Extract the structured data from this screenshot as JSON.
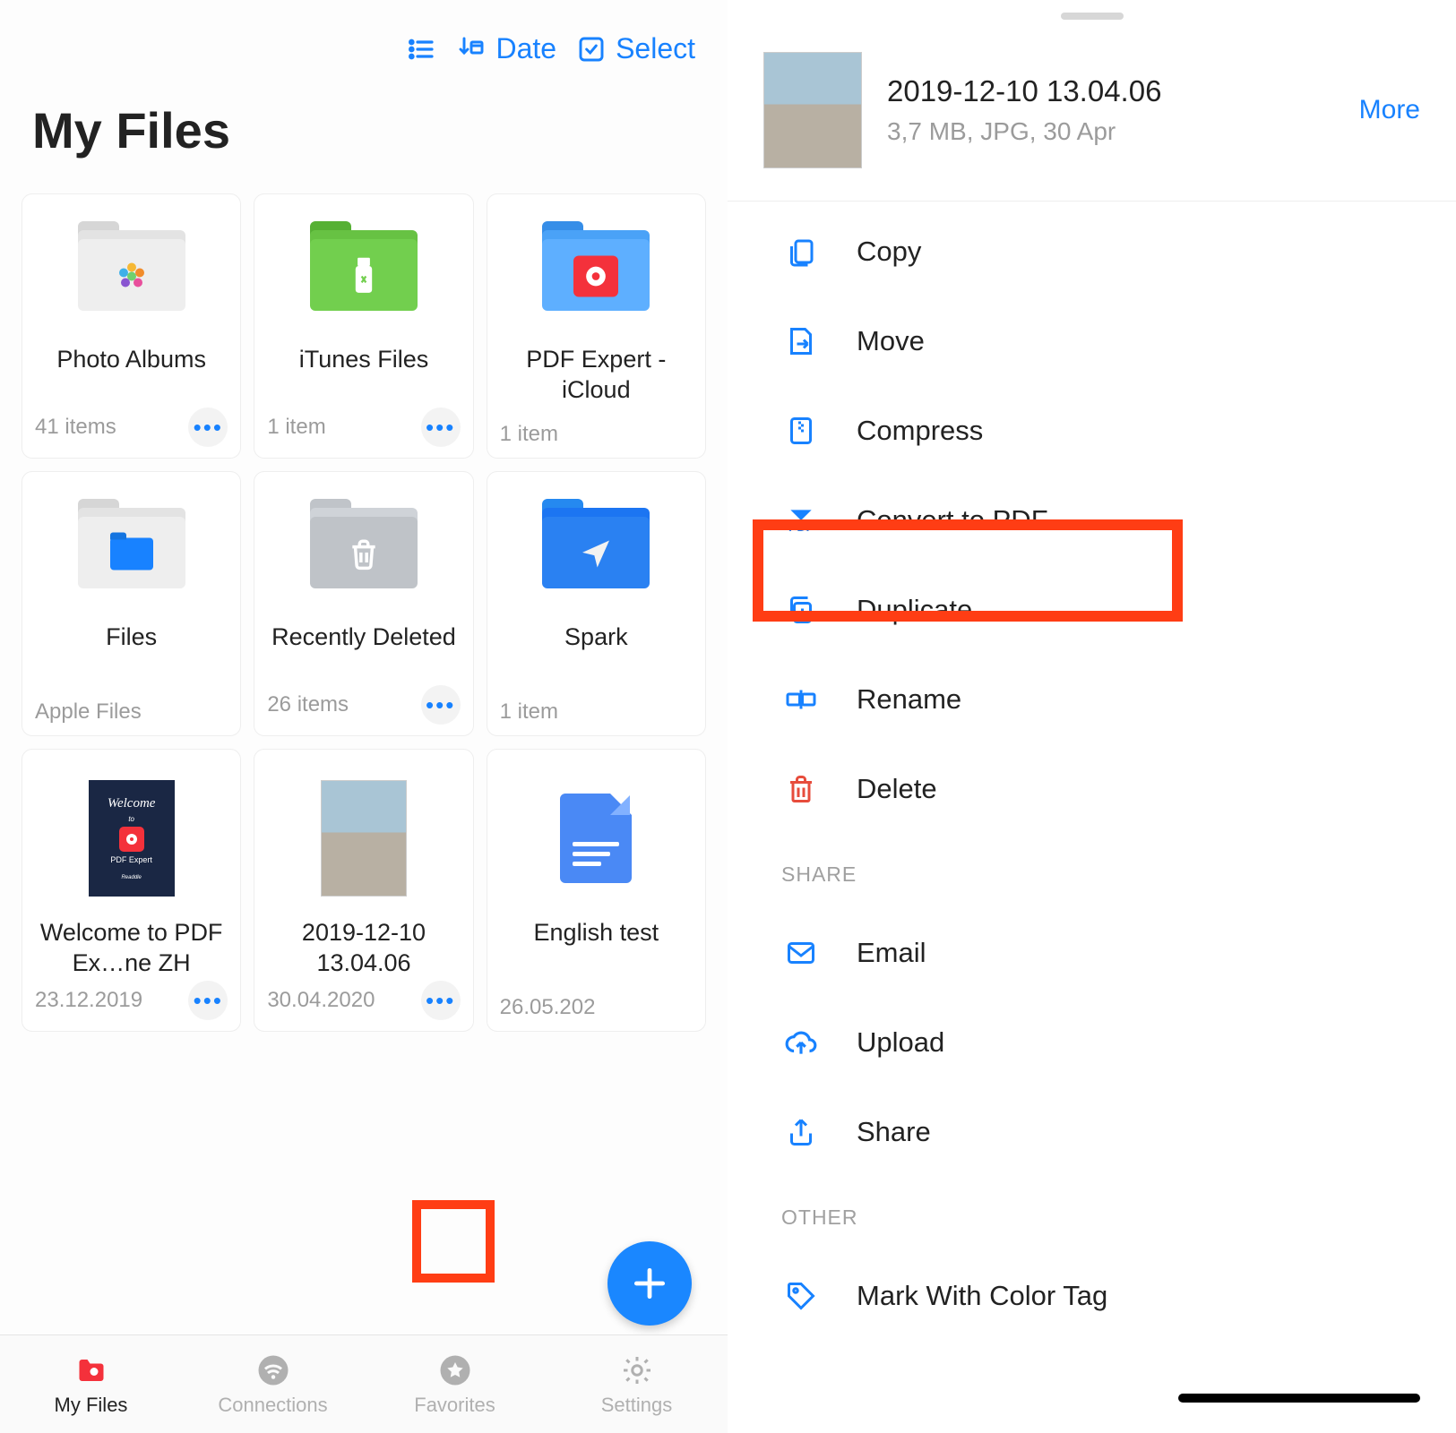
{
  "toolbar": {
    "date_label": "Date",
    "select_label": "Select"
  },
  "page_title": "My Files",
  "tiles": [
    {
      "name": "Photo Albums",
      "sub": "41 items",
      "has_more": true
    },
    {
      "name": "iTunes Files",
      "sub": "1 item",
      "has_more": true
    },
    {
      "name": "PDF Expert - iCloud",
      "sub": "1 item",
      "has_more": false
    },
    {
      "name": "Files",
      "sub": "Apple Files",
      "has_more": false
    },
    {
      "name": "Recently Deleted",
      "sub": "26 items",
      "has_more": true
    },
    {
      "name": "Spark",
      "sub": "1 item",
      "has_more": false
    },
    {
      "name": "Welcome to PDF Ex…ne ZH",
      "sub": "23.12.2019",
      "has_more": true
    },
    {
      "name": "2019-12-10 13.04.06",
      "sub": "30.04.2020",
      "has_more": true
    },
    {
      "name": "English test",
      "sub": "26.05.202",
      "has_more": false
    }
  ],
  "tabs": {
    "my_files": "My Files",
    "connections": "Connections",
    "favorites": "Favorites",
    "settings": "Settings"
  },
  "file_detail": {
    "name": "2019-12-10 13.04.06",
    "meta": "3,7 MB, JPG, 30 Apr",
    "more": "More"
  },
  "actions": {
    "copy": "Copy",
    "move": "Move",
    "compress": "Compress",
    "convert": "Convert to PDF",
    "duplicate": "Duplicate",
    "rename": "Rename",
    "delete": "Delete"
  },
  "section_share": "SHARE",
  "share_actions": {
    "email": "Email",
    "upload": "Upload",
    "share": "Share"
  },
  "section_other": "OTHER",
  "other_actions": {
    "color_tag": "Mark With Color Tag"
  }
}
